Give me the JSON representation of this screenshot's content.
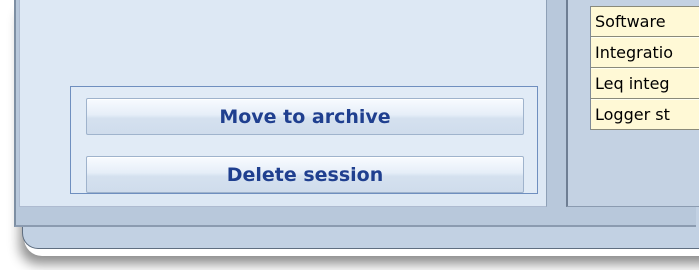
{
  "session_panel": {
    "move_to_archive_label": "Move to archive",
    "delete_session_label": "Delete session"
  },
  "info_table": {
    "rows": [
      "Software",
      "Integratio",
      "Leq integ",
      "Logger st"
    ]
  },
  "colors": {
    "button_text": "#1f3f8f",
    "table_background": "#fff9d6",
    "panel_background": "#dde8f4"
  }
}
